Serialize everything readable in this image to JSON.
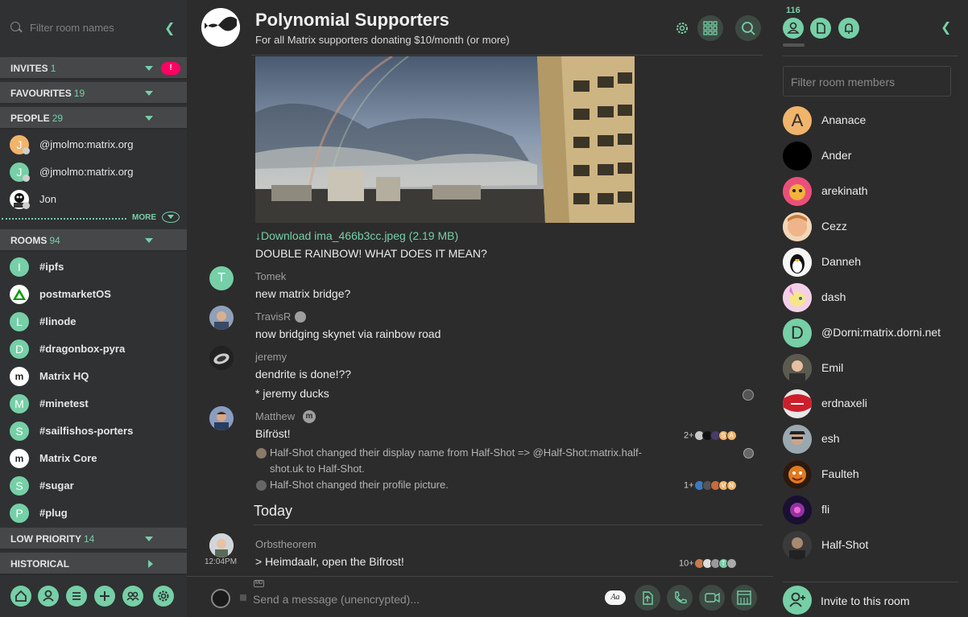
{
  "left_panel": {
    "filter_placeholder": "Filter room names",
    "sections": {
      "invites": {
        "label": "INVITES",
        "count": "1",
        "badge": "!"
      },
      "favourites": {
        "label": "FAVOURITES",
        "count": "19"
      },
      "people": {
        "label": "PEOPLE",
        "count": "29"
      },
      "rooms": {
        "label": "ROOMS",
        "count": "94"
      },
      "low_priority": {
        "label": "LOW PRIORITY",
        "count": "14"
      },
      "historical": {
        "label": "HISTORICAL"
      }
    },
    "people": [
      {
        "initial": "J",
        "name": "@jmolmo:matrix.org",
        "color": "#f0b46b"
      },
      {
        "initial": "J",
        "name": "@jmolmo:matrix.org",
        "color": "#76cfa6"
      },
      {
        "initial": "",
        "name": "Jon",
        "color": "#ffffff"
      }
    ],
    "more_label": "MORE",
    "rooms": [
      {
        "initial": "I",
        "name": "#ipfs",
        "color": "#76cfa6"
      },
      {
        "initial": "",
        "name": "postmarketOS",
        "color": "#ffffff"
      },
      {
        "initial": "L",
        "name": "#linode",
        "color": "#76cfa6"
      },
      {
        "initial": "D",
        "name": "#dragonbox-pyra",
        "color": "#76cfa6"
      },
      {
        "initial": "m",
        "name": "Matrix HQ",
        "color": "#ffffff"
      },
      {
        "initial": "M",
        "name": "#minetest",
        "color": "#76cfa6"
      },
      {
        "initial": "S",
        "name": "#sailfishos-porters",
        "color": "#76cfa6"
      },
      {
        "initial": "m",
        "name": "Matrix Core",
        "color": "#ffffff"
      },
      {
        "initial": "S",
        "name": "#sugar",
        "color": "#76cfa6"
      },
      {
        "initial": "P",
        "name": "#plug",
        "color": "#76cfa6"
      }
    ],
    "bottom_icons": [
      "home-icon",
      "person-icon",
      "list-icon",
      "plus-icon",
      "group-icon",
      "settings-icon"
    ]
  },
  "room": {
    "name": "Polynomial Supporters",
    "topic": "For all Matrix supporters donating $10/month (or more)"
  },
  "timeline": {
    "download_link": "↓Download ima_466b3cc.jpeg (2.19 MB)",
    "msg_rainbow": "DOUBLE RAINBOW! WHAT DOES IT MEAN?",
    "tomek": {
      "initial": "T",
      "name": "Tomek",
      "text": "new matrix bridge?"
    },
    "travis": {
      "name": "TravisR",
      "text": "now bridging skynet via rainbow road"
    },
    "jeremy": {
      "name": "jeremy",
      "text1": "dendrite is done!??",
      "text2": "* jeremy ducks"
    },
    "matthew": {
      "name": "Matthew",
      "text": "Bifröst!",
      "receipt_count": "2+"
    },
    "event1_line1": "Half-Shot changed their display name from Half-Shot => @Half-Shot:matrix.half-",
    "event1_line2": "shot.uk to Half-Shot.",
    "event2": "Half-Shot changed their profile picture.",
    "event2_receipt_count": "1+",
    "date_separator": "Today",
    "orbs": {
      "name": "Orbstheorem",
      "text": "> Heimdaalr, open the Bifrost!",
      "time": "12:04PM",
      "receipt_count": "10+"
    },
    "receipt_letters": {
      "s": "S",
      "a": "A",
      "v": "V",
      "n": "N",
      "t": "T"
    }
  },
  "composer": {
    "placeholder": "Send a message (unencrypted)...",
    "md_label": "MD",
    "format_label": "Aa"
  },
  "right_panel": {
    "member_count": "116",
    "filter_placeholder": "Filter room members",
    "members": [
      {
        "initial": "A",
        "name": "Ananace",
        "color": "#f0b46b"
      },
      {
        "initial": "",
        "name": "Ander",
        "color": "#000000"
      },
      {
        "initial": "",
        "name": "arekinath",
        "color": "#e8505b"
      },
      {
        "initial": "",
        "name": "Cezz",
        "color": "#e7a46a"
      },
      {
        "initial": "",
        "name": "Danneh",
        "color": "#f5f5f5"
      },
      {
        "initial": "",
        "name": "dash",
        "color": "#e9b0d8"
      },
      {
        "initial": "D",
        "name": "@Dorni:matrix.dorni.net",
        "color": "#76cfa6"
      },
      {
        "initial": "",
        "name": "Emil",
        "color": "#7a7a6a"
      },
      {
        "initial": "",
        "name": "erdnaxeli",
        "color": "#cf1f2b"
      },
      {
        "initial": "",
        "name": "esh",
        "color": "#6e7d86"
      },
      {
        "initial": "",
        "name": "Faulteh",
        "color": "#d85a1e"
      },
      {
        "initial": "",
        "name": "fli",
        "color": "#2a1a3e"
      },
      {
        "initial": "",
        "name": "Half-Shot",
        "color": "#4a4a4a"
      }
    ],
    "invite_label": "Invite to this room"
  },
  "colors": {
    "accent": "#76cfa6",
    "alert": "#ff0064",
    "bg": "#2c2c2c"
  }
}
